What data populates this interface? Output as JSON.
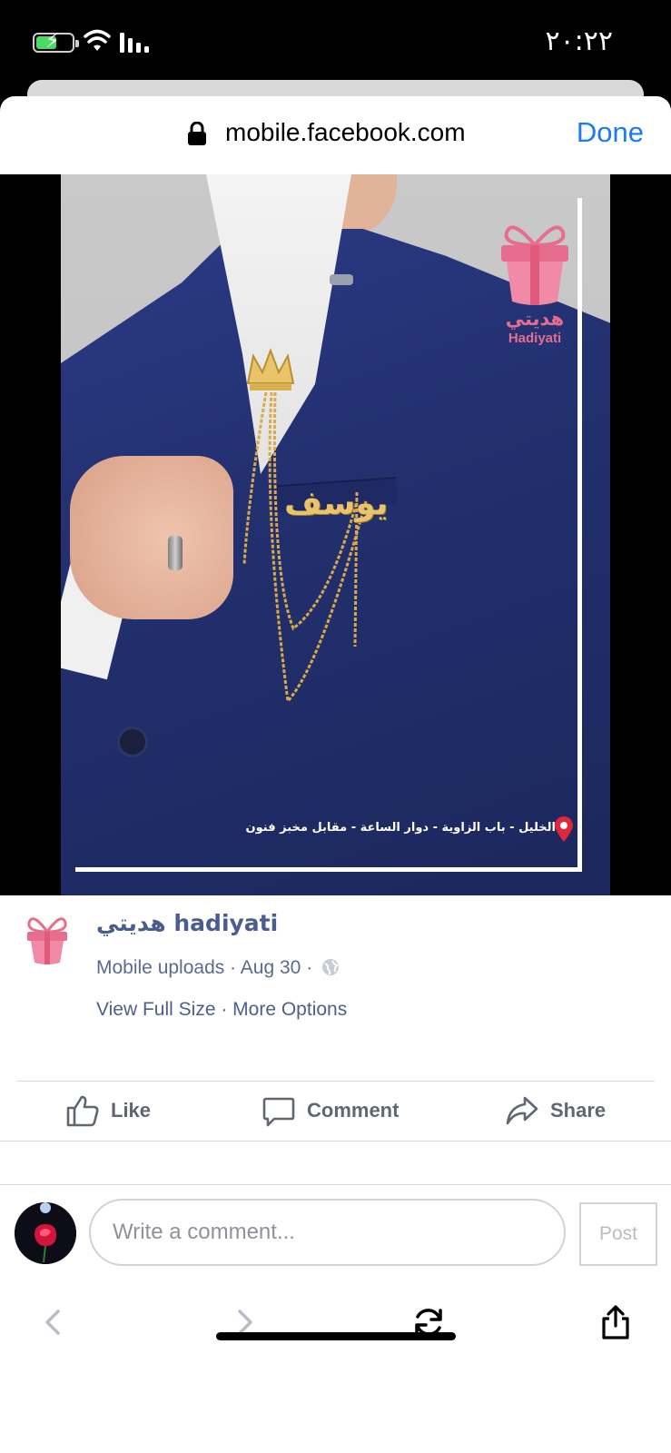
{
  "status_bar": {
    "time": "٢٠:٢٢"
  },
  "browser": {
    "url": "mobile.facebook.com",
    "done_label": "Done"
  },
  "photo": {
    "pin_name": "يوسف",
    "watermark_ar": "هديتي",
    "watermark_en": "Hadiyati",
    "address": "الخليل - باب الزاوية - دوار الساعة - مقابل مخبز فنون"
  },
  "post": {
    "page_name": "هديتي hadiyati",
    "source": "Mobile uploads",
    "date": "Aug 30",
    "view_full_size": "View Full Size",
    "more_options": "More Options"
  },
  "actions": {
    "like": "Like",
    "comment": "Comment",
    "share": "Share"
  },
  "comment_box": {
    "placeholder": "Write a comment...",
    "post_label": "Post"
  },
  "colors": {
    "link_blue": "#1a7cf0",
    "facebook_meta": "#4b5d8c",
    "brand_pink": "#e66d8d",
    "suit_navy": "#22306f",
    "chain_gold": "#e9c46a"
  },
  "icons": [
    "battery-icon",
    "wifi-icon",
    "signal-icon",
    "lock-icon",
    "location-pin-icon",
    "globe-icon",
    "like-icon",
    "comment-icon",
    "share-arrow-icon",
    "back-icon",
    "forward-icon",
    "refresh-icon",
    "share-icon"
  ]
}
